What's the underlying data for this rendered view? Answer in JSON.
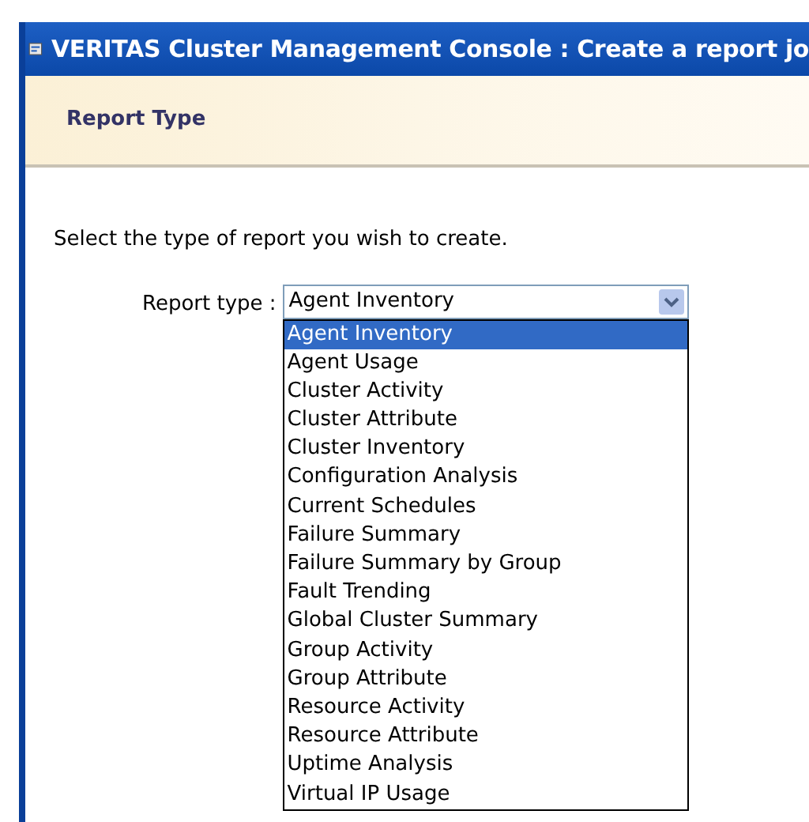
{
  "window": {
    "title": "VERITAS Cluster Management Console : Create a report jo"
  },
  "header": {
    "title": "Report Type"
  },
  "instruction": "Select the type of report you wish to create.",
  "report_type": {
    "label": "Report type :",
    "value": "Agent Inventory",
    "expanded": true,
    "options": [
      {
        "label": "Agent Inventory",
        "selected": true
      },
      {
        "label": "Agent Usage",
        "selected": false
      },
      {
        "label": "Cluster Activity",
        "selected": false
      },
      {
        "label": "Cluster Attribute",
        "selected": false
      },
      {
        "label": "Cluster Inventory",
        "selected": false
      },
      {
        "label": "Configuration Analysis",
        "selected": false
      },
      {
        "label": "Current Schedules",
        "selected": false
      },
      {
        "label": "Failure Summary",
        "selected": false
      },
      {
        "label": "Failure Summary by Group",
        "selected": false
      },
      {
        "label": "Fault Trending",
        "selected": false
      },
      {
        "label": "Global Cluster Summary",
        "selected": false
      },
      {
        "label": "Group Activity",
        "selected": false
      },
      {
        "label": "Group Attribute",
        "selected": false
      },
      {
        "label": "Resource Activity",
        "selected": false
      },
      {
        "label": "Resource Attribute",
        "selected": false
      },
      {
        "label": "Uptime Analysis",
        "selected": false
      },
      {
        "label": "Virtual IP Usage",
        "selected": false
      }
    ]
  }
}
